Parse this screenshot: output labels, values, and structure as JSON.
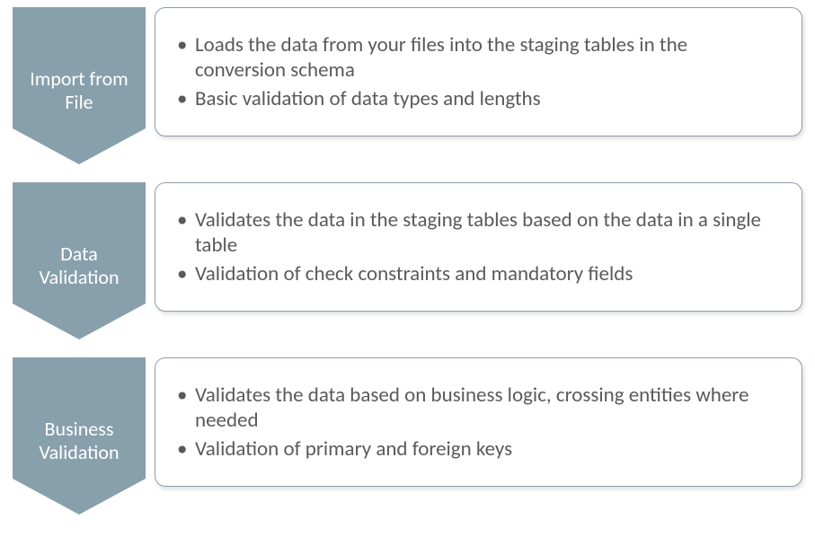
{
  "steps": [
    {
      "label": "Import from File",
      "bullets": [
        "Loads the data from your files into the staging tables in the conversion schema",
        "Basic validation of data types and lengths"
      ]
    },
    {
      "label": "Data Validation",
      "bullets": [
        "Validates the data in the staging tables based on the data in a single table",
        "Validation of check constraints and mandatory fields"
      ]
    },
    {
      "label": "Business Validation",
      "bullets": [
        "Validates the data based on business logic, crossing entities where needed",
        "Validation of primary and foreign keys"
      ]
    }
  ],
  "colors": {
    "chevron": "#88a0ac",
    "border": "#88a0ac",
    "text": "#5a5a5a"
  }
}
